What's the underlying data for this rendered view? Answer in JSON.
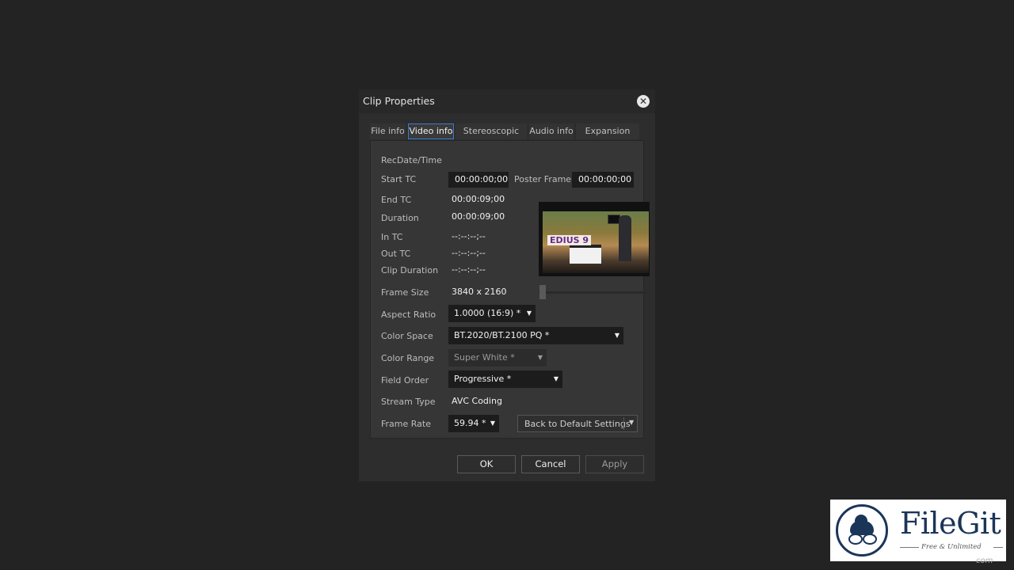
{
  "dialog": {
    "title": "Clip Properties",
    "close_icon": "close-circle-icon",
    "tabs": [
      {
        "label": "File info",
        "active": false
      },
      {
        "label": "Video info",
        "active": true
      },
      {
        "label": "Stereoscopic info",
        "active": false
      },
      {
        "label": "Audio info",
        "active": false
      },
      {
        "label": "Expansion info",
        "active": false
      }
    ],
    "video_info": {
      "recdate_label": "RecDate/Time",
      "start_tc_label": "Start TC",
      "start_tc_value": "00:00:00;00",
      "poster_frame_label": "Poster Frame",
      "poster_frame_value": "00:00:00;00",
      "end_tc_label": "End TC",
      "end_tc_value": "00:00:09;00",
      "duration_label": "Duration",
      "duration_value": "00:00:09;00",
      "in_tc_label": "In TC",
      "in_tc_value": "--:--:--;--",
      "out_tc_label": "Out TC",
      "out_tc_value": "--:--:--;--",
      "clip_duration_label": "Clip Duration",
      "clip_duration_value": "--:--:--;--",
      "frame_size_label": "Frame Size",
      "frame_size_value": "3840 x 2160",
      "aspect_ratio_label": "Aspect Ratio",
      "aspect_ratio_value": "1.0000 (16:9) *",
      "color_space_label": "Color Space",
      "color_space_value": "BT.2020/BT.2100 PQ *",
      "color_range_label": "Color Range",
      "color_range_value": "Super White *",
      "field_order_label": "Field Order",
      "field_order_value": "Progressive *",
      "stream_type_label": "Stream Type",
      "stream_type_value": "AVC Coding",
      "frame_rate_label": "Frame Rate",
      "frame_rate_value": "59.94 *",
      "default_settings_label": "Back to Default Settings",
      "thumbnail_logo_text": "EDIUS 9",
      "poster_slider_position": 0
    },
    "buttons": {
      "ok": "OK",
      "cancel": "Cancel",
      "apply": "Apply"
    }
  },
  "watermark": {
    "name": "FileGit",
    "tagline": "Free & Unlimited",
    "corner_text": "com"
  },
  "colors": {
    "background": "#232323",
    "dialog": "#2d2d2d",
    "active_tab_border": "#3c7bd6",
    "logo_navy": "#1b3558"
  }
}
